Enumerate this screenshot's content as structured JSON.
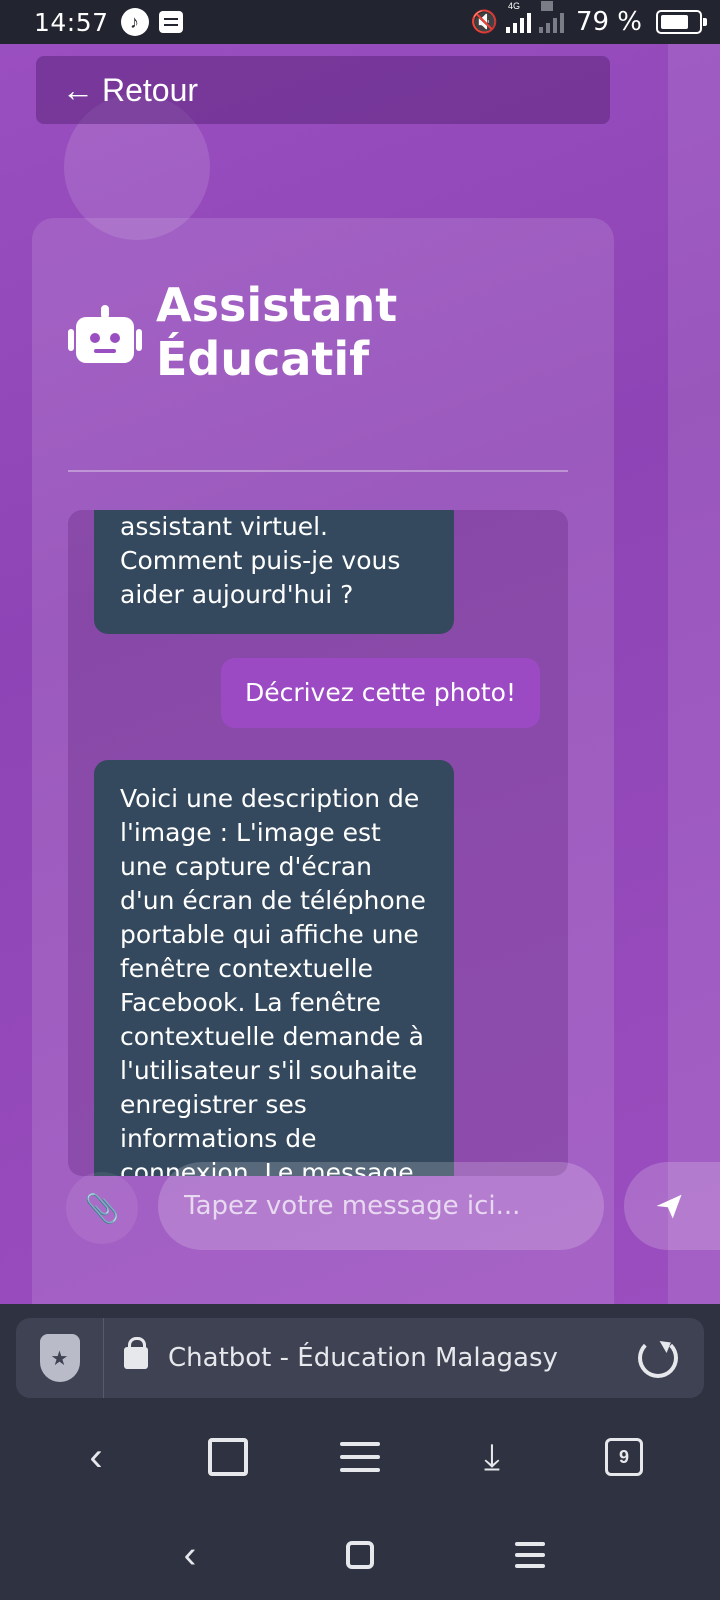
{
  "status_bar": {
    "time": "14:57",
    "network_1": "4G",
    "network_2": "4G",
    "battery_percent": "79 %",
    "battery_level": 0.79
  },
  "header": {
    "back_label": "Retour",
    "title_line1": "Assistant",
    "title_line2": "Éducatif"
  },
  "chat": {
    "messages": [
      {
        "role": "bot",
        "text": "assistant virtuel. Comment puis-je vous aider aujourd'hui ?"
      },
      {
        "role": "user",
        "text": "Décrivez cette photo!"
      },
      {
        "role": "bot",
        "text": "Voici une description de l'image : L'image est une capture d'écran d'un écran de téléphone portable qui affiche une fenêtre contextuelle Facebook. La fenêtre contextuelle demande à l'utilisateur s'il souhaite enregistrer ses informations de connexion. Le message"
      }
    ]
  },
  "composer": {
    "placeholder": "Tapez votre message ici..."
  },
  "browser": {
    "url_title": "Chatbot - Éducation Malagasy",
    "tab_count": "9"
  },
  "colors": {
    "page_purple": "#9a4fc0",
    "bot_bubble": "#34495e",
    "user_bubble": "#9c4ac4"
  }
}
